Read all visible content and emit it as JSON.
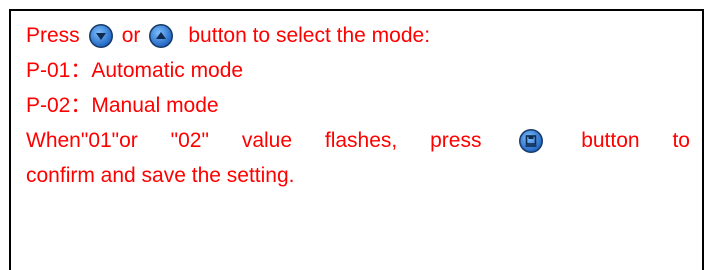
{
  "instructions": {
    "line1": {
      "press": "Press",
      "down_icon": "arrow-down-circle-icon",
      "or": "or",
      "up_icon": "arrow-up-circle-icon",
      "tail": "button to select the mode:"
    },
    "line2": "P-01：Automatic mode",
    "line3": "P-02：Manual mode",
    "line4": {
      "w1": "When\"01\"or",
      "w2": "\"02\"",
      "w3": "value",
      "w4": "flashes,",
      "w5": "press",
      "save_icon": "save-circle-icon",
      "w6": "button",
      "w7": "to"
    },
    "line5": "confirm and save the setting."
  },
  "colors": {
    "text": "#ff0000",
    "border": "#000000",
    "icon_blue": "#1e73d8"
  }
}
